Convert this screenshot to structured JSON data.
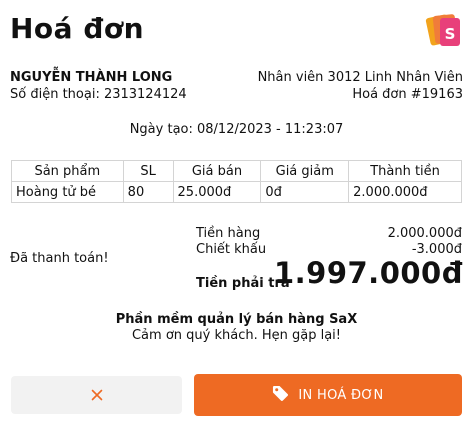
{
  "header": {
    "title": "Hoá đơn",
    "logo_icon": "sax-logo-icon"
  },
  "customer": {
    "name": "NGUYỄN THÀNH LONG",
    "phone": "Số điện thoại: 2313124124"
  },
  "staff": {
    "label": "Nhân viên 3012 Linh Nhân Viên",
    "invoice_no": "Hoá đơn #19163"
  },
  "created_at": "Ngày tạo: 08/12/2023 - 11:23:07",
  "table": {
    "headers": [
      "Sản phẩm",
      "SL",
      "Giá bán",
      "Giá giảm",
      "Thành tiền"
    ],
    "rows": [
      [
        "Hoàng tử bé",
        "80",
        "25.000đ",
        "0đ",
        "2.000.000đ"
      ]
    ]
  },
  "payment": {
    "status": "Đã thanh toán!",
    "subtotal_label": "Tiền hàng",
    "subtotal_value": "2.000.000đ",
    "discount_label": "Chiết khấu",
    "discount_value": "-3.000đ",
    "total_label": "Tiền phải trả",
    "total_value": "1.997.000đ"
  },
  "footer": {
    "line1": "Phần mềm quản lý bán hàng SaX",
    "line2": "Cảm ơn quý khách. Hẹn gặp lại!"
  },
  "buttons": {
    "close_icon": "close-icon",
    "print_icon": "tag-icon",
    "print_label": "IN HOÁ ĐƠN"
  },
  "colors": {
    "accent": "#ee6a23",
    "logo_pink": "#e8407a",
    "logo_orange": "#f2a31c"
  }
}
